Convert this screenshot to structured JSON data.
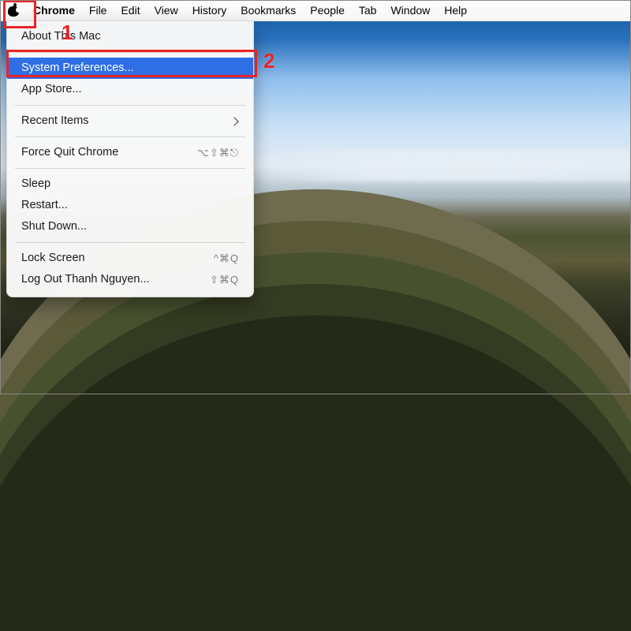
{
  "menu_bar": {
    "app_name": "Chrome",
    "items": [
      "File",
      "Edit",
      "View",
      "History",
      "Bookmarks",
      "People",
      "Tab",
      "Window",
      "Help"
    ]
  },
  "apple_menu": {
    "about": "About This Mac",
    "system_preferences": "System Preferences...",
    "app_store": "App Store...",
    "recent_items": "Recent Items",
    "force_quit": "Force Quit Chrome",
    "force_quit_shortcut": "⌥⇧⌘⎋",
    "sleep": "Sleep",
    "restart": "Restart...",
    "shutdown": "Shut Down...",
    "lock_screen": "Lock Screen",
    "lock_screen_shortcut": "^⌘Q",
    "logout": "Log Out Thanh Nguyen...",
    "logout_shortcut": "⇧⌘Q"
  },
  "annotations": {
    "one": "1",
    "two": "2"
  }
}
